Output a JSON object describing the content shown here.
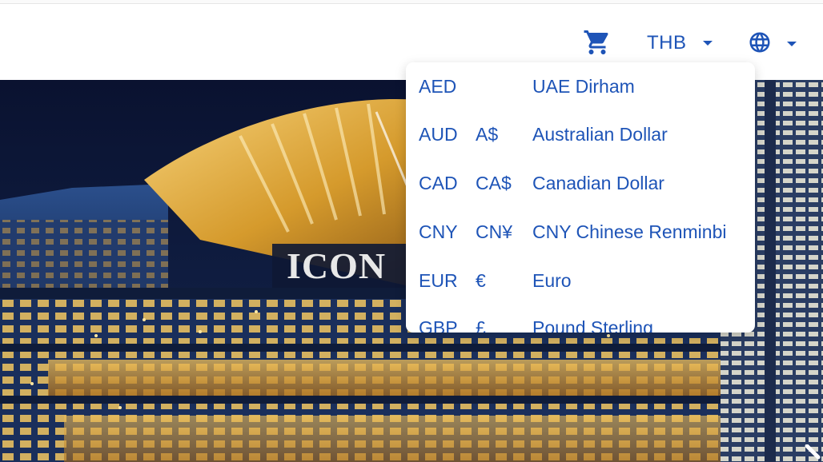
{
  "header": {
    "cart_icon": "shopping-cart-icon",
    "currency": "THB",
    "language_icon": "globe-icon",
    "accent_color": "#1e54b7"
  },
  "hero": {
    "sign_text": "ICON"
  },
  "currency_menu": {
    "items": [
      {
        "code": "AED",
        "symbol": "",
        "name": "UAE Dirham"
      },
      {
        "code": "AUD",
        "symbol": "A$",
        "name": "Australian Dollar"
      },
      {
        "code": "CAD",
        "symbol": "CA$",
        "name": "Canadian Dollar"
      },
      {
        "code": "CNY",
        "symbol": "CN¥",
        "name": "CNY Chinese Renminbi"
      },
      {
        "code": "EUR",
        "symbol": "€",
        "name": "Euro"
      },
      {
        "code": "GBP",
        "symbol": "£",
        "name": "Pound Sterling"
      }
    ]
  }
}
